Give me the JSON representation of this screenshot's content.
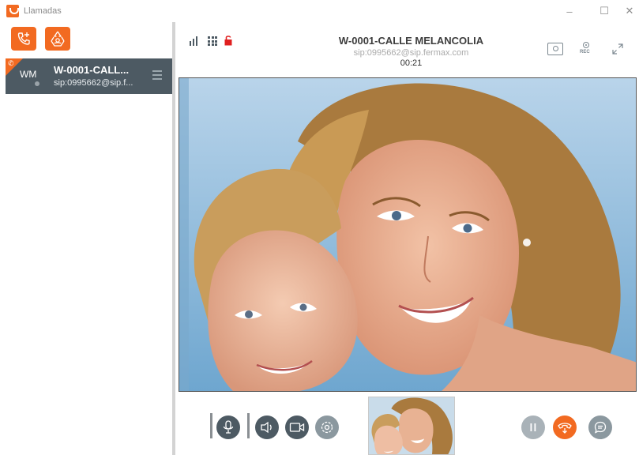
{
  "window": {
    "title": "Llamadas",
    "controls": {
      "minimize": "–",
      "maximize": "☐",
      "close": "✕"
    }
  },
  "sidebar": {
    "buttons": [
      {
        "name": "new-call",
        "icon": "phone-plus-icon"
      },
      {
        "name": "conference",
        "icon": "conference-recycle-icon"
      }
    ],
    "call_item": {
      "avatar_initials": "WM",
      "name": "W-0001-CALL...",
      "sip": "sip:0995662@sip.f..."
    }
  },
  "call": {
    "title": "W-0001-CALLE MELANCOLIA",
    "sip": "sip:0995662@sip.fermax.com",
    "timer": "00:21",
    "rec_label": "REC"
  },
  "colors": {
    "accent": "#f26a21",
    "dark": "#4d5a63",
    "grey_button": "#8b989f",
    "hold_button": "#a9b2b8",
    "lock_red": "#e02020"
  },
  "controls": {
    "icons": [
      "microphone-icon",
      "speaker-icon",
      "camera-icon",
      "settings-icon",
      "pause-icon",
      "hangup-icon",
      "chat-icon"
    ]
  }
}
